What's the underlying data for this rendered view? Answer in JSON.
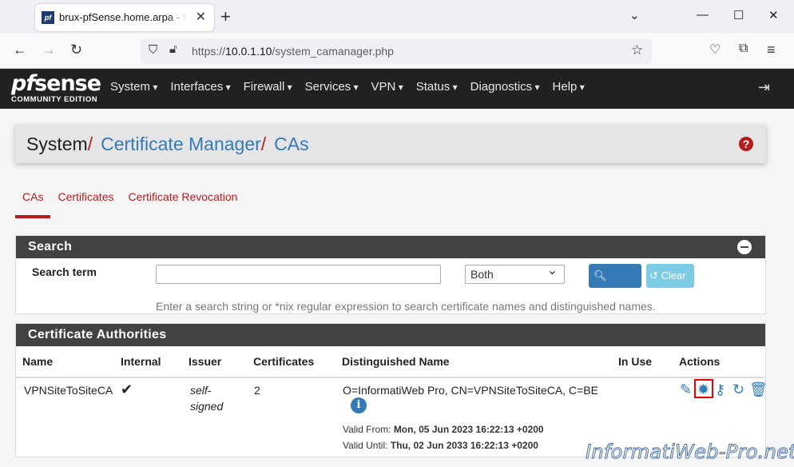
{
  "browser": {
    "tab_title": "brux-pfSense.home.arpa - System: Certificate Manager: CAs",
    "favicon_text": "pf",
    "url_prefix": "https://",
    "url_host": "10.0.1.10",
    "url_path": "/system_camanager.php"
  },
  "header": {
    "logo_pf": "pf",
    "logo_sense": "sense",
    "logo_sub": "COMMUNITY EDITION",
    "menu": [
      "System",
      "Interfaces",
      "Firewall",
      "Services",
      "VPN",
      "Status",
      "Diagnostics",
      "Help"
    ]
  },
  "breadcrumb": {
    "root": "System",
    "section": "Certificate Manager",
    "page": "CAs",
    "separator": "/",
    "help": "?"
  },
  "tabs": [
    "CAs",
    "Certificates",
    "Certificate Revocation"
  ],
  "search": {
    "title": "Search",
    "label": "Search term",
    "value": "",
    "select_value": "Both",
    "search_button": "Search",
    "clear_button": "Clear",
    "hint": "Enter a search string or *nix regular expression to search certificate names and distinguished names."
  },
  "ca_table": {
    "title": "Certificate Authorities",
    "columns": [
      "Name",
      "Internal",
      "Issuer",
      "Certificates",
      "Distinguished Name",
      "In Use",
      "Actions"
    ],
    "rows": [
      {
        "name": "VPNSiteToSiteCA",
        "internal": "✔",
        "issuer_line1": "self-",
        "issuer_line2": "signed",
        "certificates": "2",
        "dn": "O=InformatiWeb Pro, CN=VPNSiteToSiteCA, C=BE",
        "info": "i",
        "valid_from_label": "Valid From:",
        "valid_from": "Mon, 05 Jun 2023 16:22:13 +0200",
        "valid_until_label": "Valid Until:",
        "valid_until": "Thu, 02 Jun 2033 16:22:13 +0200",
        "in_use": "",
        "actions": [
          "pencil-icon",
          "certificate-icon",
          "key-icon",
          "renew-icon",
          "trash-icon"
        ]
      }
    ]
  },
  "watermark": "InformatiWeb-Pro.net",
  "colors": {
    "brand_red": "#b71c1c",
    "link_blue": "#337ab7",
    "header_dark": "#212121",
    "panel_heading": "#424242"
  }
}
